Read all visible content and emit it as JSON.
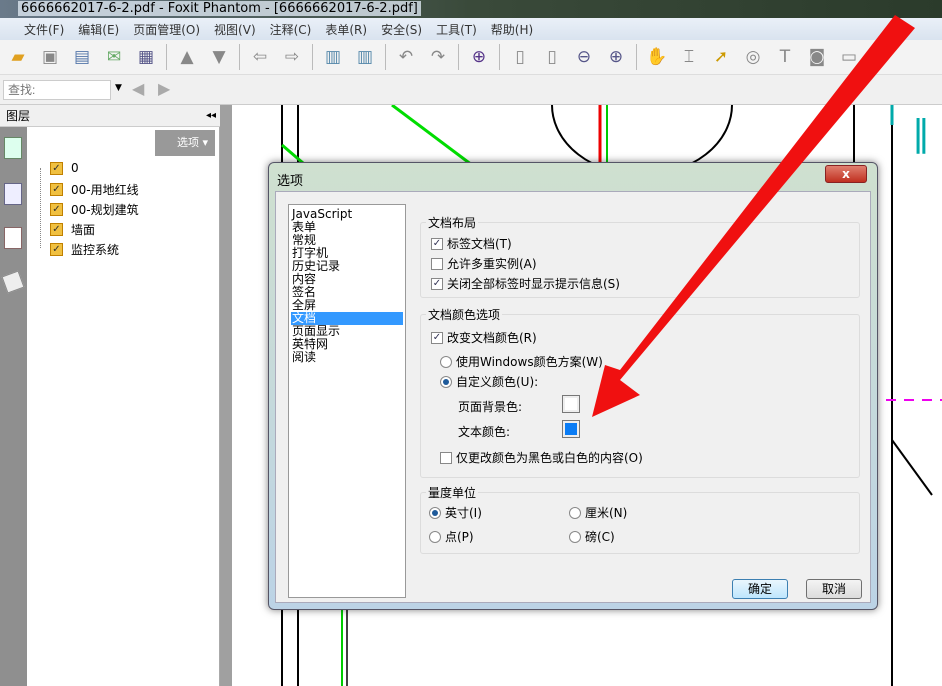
{
  "window": {
    "title": "6666662017-6-2.pdf - Foxit Phantom - [6666662017-6-2.pdf]"
  },
  "menu": [
    "文件(F)",
    "编辑(E)",
    "页面管理(O)",
    "视图(V)",
    "注释(C)",
    "表单(R)",
    "安全(S)",
    "工具(T)",
    "帮助(H)"
  ],
  "find": {
    "placeholder": "查找:"
  },
  "layers": {
    "title": "图层",
    "options_label": "选项",
    "items": [
      "0",
      "00-用地红线",
      "00-规划建筑",
      "墙面",
      "监控系统"
    ]
  },
  "dialog": {
    "title": "选项",
    "close_label": "x",
    "categories": [
      "JavaScript",
      "表单",
      "常规",
      "打字机",
      "历史记录",
      "内容",
      "签名",
      "全屏",
      "文档",
      "页面显示",
      "英特网",
      "阅读"
    ],
    "selected_category": "文档",
    "layout_group": {
      "title": "文档布局",
      "tab_docs": "标签文档(T)",
      "multi_instance": "允许多重实例(A)",
      "close_tip": "关闭全部标签时显示提示信息(S)"
    },
    "color_group": {
      "title": "文档颜色选项",
      "change_color": "改变文档颜色(R)",
      "use_windows": "使用Windows颜色方案(W)",
      "custom": "自定义颜色(U):",
      "page_bg": "页面背景色:",
      "text_color": "文本颜色:",
      "only_bw": "仅更改颜色为黑色或白色的内容(O)",
      "page_bg_value": "#ffffff",
      "text_color_value": "#0a7cf5"
    },
    "units_group": {
      "title": "量度单位",
      "inch": "英寸(I)",
      "cm": "厘米(N)",
      "point": "点(P)",
      "pica": "磅(C)"
    },
    "ok": "确定",
    "cancel": "取消"
  }
}
